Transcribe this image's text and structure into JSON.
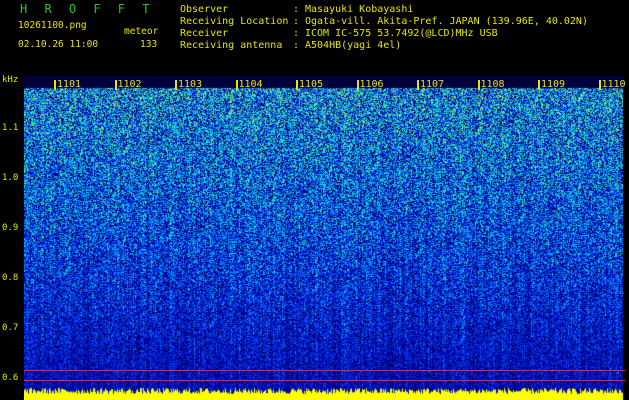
{
  "header": {
    "title": "H R O F F T",
    "filename": "10261100.png",
    "event_label": "meteor",
    "datetime": "02.10.26 11:00",
    "count": "133",
    "fields": [
      {
        "label": "Observer",
        "sep": ":",
        "value": "Masayuki Kobayashi"
      },
      {
        "label": "Receiving Location",
        "sep": ":",
        "value": "Ogata-vill. Akita-Pref. JAPAN (139.96E, 40.02N)"
      },
      {
        "label": "Receiver",
        "sep": ":",
        "value": "ICOM IC-575 53.7492(@LCD)MHz USB"
      },
      {
        "label": "Receiving antenna",
        "sep": ":",
        "value": "A504HB(yagi 4el)"
      }
    ]
  },
  "yaxis": {
    "unit": "kHz",
    "ticks": [
      "1.1",
      "1.0",
      "0.9",
      "0.8",
      "0.7",
      "0.6"
    ]
  },
  "xaxis": {
    "ticks": [
      "1101",
      "1102",
      "1103",
      "1104",
      "1105",
      "1106",
      "1107",
      "1108",
      "1109",
      "1110"
    ]
  },
  "colors": {
    "background": "#000000",
    "header_text": "#e6e600",
    "title": "#22c722",
    "marker_red": "#ff2020",
    "spectrum_low": "#000080",
    "spectrum_mid": "#0050ff",
    "spectrum_high": "#00e0c0",
    "baseline_yellow": "#ffff00"
  }
}
